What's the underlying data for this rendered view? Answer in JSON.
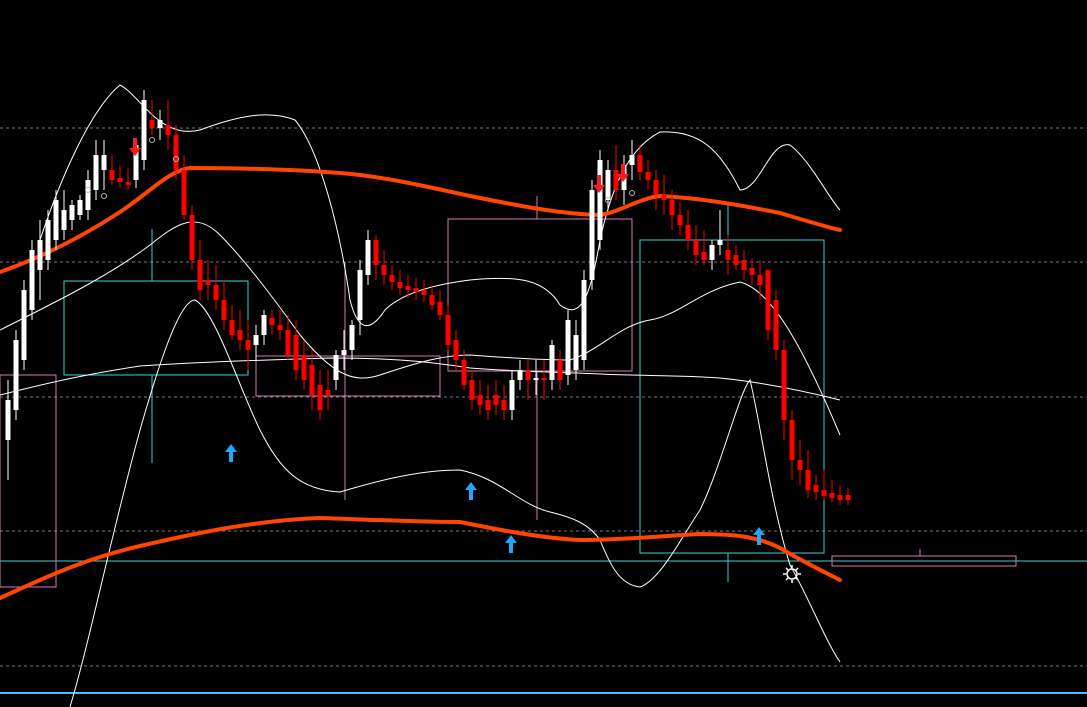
{
  "colors": {
    "background": "#000000",
    "bull_candle": "#ffffff",
    "bear_candle": "#ff0000",
    "envelope": "#ff4500",
    "bollinger": "#ffffff",
    "box_cyan": "#3ad1d1",
    "box_pink": "#d77ab2",
    "grid": "#7a7a7a",
    "signal_up": "#1ea7ff",
    "signal_down": "#ff1a1a",
    "level_line": "#4fb7ff"
  },
  "chart_data": {
    "type": "candlestick",
    "title": "",
    "xlabel": "",
    "ylabel": "",
    "grid": "horizontal-dashed",
    "ylim": [
      60,
      700
    ],
    "candles": [
      {
        "o": 500,
        "h": 440,
        "l": 540,
        "c": 460
      },
      {
        "o": 470,
        "h": 390,
        "l": 480,
        "c": 400
      },
      {
        "o": 420,
        "h": 340,
        "l": 430,
        "c": 350
      },
      {
        "o": 370,
        "h": 300,
        "l": 380,
        "c": 310
      },
      {
        "o": 330,
        "h": 280,
        "l": 360,
        "c": 300
      },
      {
        "o": 320,
        "h": 270,
        "l": 330,
        "c": 280
      },
      {
        "o": 300,
        "h": 250,
        "l": 310,
        "c": 260
      },
      {
        "o": 290,
        "h": 250,
        "l": 300,
        "c": 270
      },
      {
        "o": 280,
        "h": 260,
        "l": 290,
        "c": 265
      },
      {
        "o": 275,
        "h": 255,
        "l": 280,
        "c": 260
      },
      {
        "o": 270,
        "h": 230,
        "l": 280,
        "c": 240
      },
      {
        "o": 250,
        "h": 200,
        "l": 260,
        "c": 215
      },
      {
        "o": 230,
        "h": 200,
        "l": 250,
        "c": 215
      },
      {
        "o": 230,
        "h": 215,
        "l": 245,
        "c": 240
      },
      {
        "o": 238,
        "h": 225,
        "l": 248,
        "c": 242
      },
      {
        "o": 242,
        "h": 228,
        "l": 250,
        "c": 245
      },
      {
        "o": 240,
        "h": 200,
        "l": 248,
        "c": 205
      },
      {
        "o": 220,
        "h": 150,
        "l": 230,
        "c": 160
      },
      {
        "o": 180,
        "h": 160,
        "l": 195,
        "c": 188
      },
      {
        "o": 188,
        "h": 170,
        "l": 200,
        "c": 180
      },
      {
        "o": 185,
        "h": 160,
        "l": 210,
        "c": 195
      },
      {
        "o": 195,
        "h": 185,
        "l": 240,
        "c": 230
      },
      {
        "o": 230,
        "h": 215,
        "l": 280,
        "c": 275
      },
      {
        "o": 275,
        "h": 265,
        "l": 330,
        "c": 320
      },
      {
        "o": 320,
        "h": 300,
        "l": 360,
        "c": 350
      },
      {
        "o": 340,
        "h": 320,
        "l": 360,
        "c": 345
      },
      {
        "o": 345,
        "h": 325,
        "l": 370,
        "c": 360
      },
      {
        "o": 360,
        "h": 340,
        "l": 390,
        "c": 380
      },
      {
        "o": 380,
        "h": 365,
        "l": 400,
        "c": 395
      },
      {
        "o": 390,
        "h": 370,
        "l": 410,
        "c": 400
      },
      {
        "o": 400,
        "h": 380,
        "l": 430,
        "c": 410
      },
      {
        "o": 405,
        "h": 385,
        "l": 420,
        "c": 395
      },
      {
        "o": 395,
        "h": 370,
        "l": 405,
        "c": 375
      },
      {
        "o": 378,
        "h": 370,
        "l": 395,
        "c": 385
      },
      {
        "o": 385,
        "h": 370,
        "l": 400,
        "c": 390
      },
      {
        "o": 390,
        "h": 375,
        "l": 420,
        "c": 415
      },
      {
        "o": 395,
        "h": 380,
        "l": 440,
        "c": 430
      },
      {
        "o": 415,
        "h": 400,
        "l": 450,
        "c": 440
      },
      {
        "o": 425,
        "h": 410,
        "l": 470,
        "c": 455
      },
      {
        "o": 445,
        "h": 430,
        "l": 480,
        "c": 470
      },
      {
        "o": 450,
        "h": 430,
        "l": 470,
        "c": 455
      },
      {
        "o": 440,
        "h": 410,
        "l": 450,
        "c": 415
      },
      {
        "o": 415,
        "h": 390,
        "l": 430,
        "c": 410
      },
      {
        "o": 410,
        "h": 380,
        "l": 420,
        "c": 385
      },
      {
        "o": 380,
        "h": 320,
        "l": 395,
        "c": 330
      },
      {
        "o": 335,
        "h": 290,
        "l": 345,
        "c": 300
      },
      {
        "o": 300,
        "h": 295,
        "l": 340,
        "c": 325
      },
      {
        "o": 325,
        "h": 310,
        "l": 345,
        "c": 335
      },
      {
        "o": 335,
        "h": 325,
        "l": 350,
        "c": 342
      },
      {
        "o": 342,
        "h": 330,
        "l": 355,
        "c": 348
      },
      {
        "o": 346,
        "h": 335,
        "l": 358,
        "c": 350
      },
      {
        "o": 348,
        "h": 338,
        "l": 360,
        "c": 352
      },
      {
        "o": 350,
        "h": 340,
        "l": 362,
        "c": 355
      },
      {
        "o": 355,
        "h": 345,
        "l": 370,
        "c": 365
      },
      {
        "o": 362,
        "h": 350,
        "l": 380,
        "c": 375
      },
      {
        "o": 375,
        "h": 365,
        "l": 410,
        "c": 405
      },
      {
        "o": 400,
        "h": 390,
        "l": 430,
        "c": 420
      },
      {
        "o": 420,
        "h": 410,
        "l": 450,
        "c": 445
      },
      {
        "o": 440,
        "h": 430,
        "l": 470,
        "c": 460
      },
      {
        "o": 455,
        "h": 440,
        "l": 475,
        "c": 465
      },
      {
        "o": 460,
        "h": 445,
        "l": 480,
        "c": 470
      },
      {
        "o": 455,
        "h": 440,
        "l": 475,
        "c": 465
      },
      {
        "o": 460,
        "h": 445,
        "l": 480,
        "c": 470
      },
      {
        "o": 470,
        "h": 430,
        "l": 480,
        "c": 440
      },
      {
        "o": 440,
        "h": 420,
        "l": 450,
        "c": 430
      },
      {
        "o": 430,
        "h": 420,
        "l": 460,
        "c": 440
      },
      {
        "o": 440,
        "h": 420,
        "l": 455,
        "c": 438
      },
      {
        "o": 438,
        "h": 420,
        "l": 460,
        "c": 440
      },
      {
        "o": 440,
        "h": 400,
        "l": 450,
        "c": 405
      },
      {
        "o": 420,
        "h": 410,
        "l": 450,
        "c": 440
      },
      {
        "o": 435,
        "h": 370,
        "l": 445,
        "c": 380
      },
      {
        "o": 430,
        "h": 380,
        "l": 440,
        "c": 395
      },
      {
        "o": 420,
        "h": 330,
        "l": 430,
        "c": 340
      },
      {
        "o": 340,
        "h": 240,
        "l": 350,
        "c": 250
      },
      {
        "o": 300,
        "h": 210,
        "l": 310,
        "c": 220
      },
      {
        "o": 260,
        "h": 220,
        "l": 270,
        "c": 230
      },
      {
        "o": 230,
        "h": 205,
        "l": 260,
        "c": 250
      },
      {
        "o": 250,
        "h": 215,
        "l": 265,
        "c": 225
      },
      {
        "o": 225,
        "h": 200,
        "l": 240,
        "c": 215
      },
      {
        "o": 215,
        "h": 205,
        "l": 240,
        "c": 232
      },
      {
        "o": 232,
        "h": 220,
        "l": 250,
        "c": 240
      },
      {
        "o": 240,
        "h": 230,
        "l": 270,
        "c": 255
      },
      {
        "o": 255,
        "h": 235,
        "l": 275,
        "c": 260
      },
      {
        "o": 260,
        "h": 250,
        "l": 290,
        "c": 275
      },
      {
        "o": 275,
        "h": 262,
        "l": 295,
        "c": 285
      },
      {
        "o": 285,
        "h": 270,
        "l": 310,
        "c": 300
      },
      {
        "o": 300,
        "h": 285,
        "l": 325,
        "c": 315
      },
      {
        "o": 312,
        "h": 290,
        "l": 325,
        "c": 320
      },
      {
        "o": 320,
        "h": 300,
        "l": 330,
        "c": 305
      },
      {
        "o": 305,
        "h": 270,
        "l": 315,
        "c": 300
      },
      {
        "o": 310,
        "h": 295,
        "l": 335,
        "c": 320
      },
      {
        "o": 315,
        "h": 305,
        "l": 330,
        "c": 325
      },
      {
        "o": 320,
        "h": 310,
        "l": 340,
        "c": 330
      },
      {
        "o": 328,
        "h": 318,
        "l": 345,
        "c": 335
      },
      {
        "o": 335,
        "h": 320,
        "l": 360,
        "c": 345
      },
      {
        "o": 330,
        "h": 330,
        "l": 400,
        "c": 390
      },
      {
        "o": 360,
        "h": 350,
        "l": 420,
        "c": 410
      },
      {
        "o": 410,
        "h": 400,
        "l": 500,
        "c": 480
      },
      {
        "o": 480,
        "h": 470,
        "l": 540,
        "c": 520
      },
      {
        "o": 520,
        "h": 500,
        "l": 545,
        "c": 530
      },
      {
        "o": 530,
        "h": 510,
        "l": 558,
        "c": 550
      },
      {
        "o": 545,
        "h": 535,
        "l": 560,
        "c": 552
      },
      {
        "o": 550,
        "h": 530,
        "l": 560,
        "c": 556
      },
      {
        "o": 553,
        "h": 540,
        "l": 562,
        "c": 558
      },
      {
        "o": 555,
        "h": 545,
        "l": 565,
        "c": 560
      },
      {
        "o": 555,
        "h": 548,
        "l": 565,
        "c": 560
      }
    ]
  }
}
